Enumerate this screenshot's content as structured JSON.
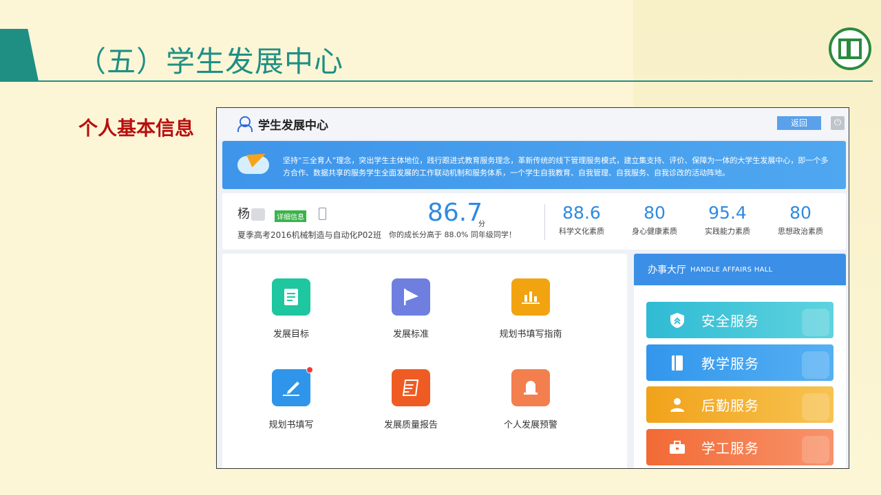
{
  "slide": {
    "title": "（五）学生发展中心",
    "section_label": "个人基本信息"
  },
  "app": {
    "title": "学生发展中心",
    "back_label": "返回",
    "banner_text": "坚持“三全育人”理念，突出学生主体地位，践行跟进式教育服务理念，革新传统的线下管理服务模式，建立集支持、评价、保障为一体的大学生发展中心，即一个多方合作、数据共享的服务学生全面发展的工作联动机制和服务体系，一个学生自我教育、自我管理、自我服务、自我诊改的活动阵地。"
  },
  "profile": {
    "name": "杨",
    "detail_badge": "详细信息",
    "class_name": "夏季高考2016机械制造与自动化P02班",
    "score": "86.7",
    "score_unit": "分",
    "rank_text": "你的成长分高于 88.0% 同年级同学！",
    "metrics": [
      {
        "value": "88.6",
        "label": "科学文化素质"
      },
      {
        "value": "80",
        "label": "身心健康素质"
      },
      {
        "value": "95.4",
        "label": "实践能力素质"
      },
      {
        "value": "80",
        "label": "思想政治素质"
      }
    ]
  },
  "tiles": [
    {
      "label": "发展目标",
      "icon": "document-icon",
      "color": "#1ec7a0"
    },
    {
      "label": "发展标准",
      "icon": "flag-icon",
      "color": "#6e7fe0"
    },
    {
      "label": "规划书填写指南",
      "icon": "bar-chart-icon",
      "color": "#f2a310"
    },
    {
      "label": "规划书填写",
      "icon": "pen-icon",
      "color": "#2f95ea"
    },
    {
      "label": "发展质量报告",
      "icon": "report-icon",
      "color": "#ee5c24"
    },
    {
      "label": "个人发展预警",
      "icon": "bell-icon",
      "color": "#f37f4f"
    }
  ],
  "affairs": {
    "title": "办事大厅",
    "subtitle": "HANDLE AFFAIRS HALL",
    "services": [
      {
        "label": "安全服务",
        "icon": "shield-icon",
        "color": "#33c0d6"
      },
      {
        "label": "教学服务",
        "icon": "book-icon",
        "color": "#3a9ff0"
      },
      {
        "label": "后勤服务",
        "icon": "person-icon",
        "color": "#f3ac27"
      },
      {
        "label": "学工服务",
        "icon": "briefcase-icon",
        "color": "#f46d3a"
      }
    ]
  }
}
